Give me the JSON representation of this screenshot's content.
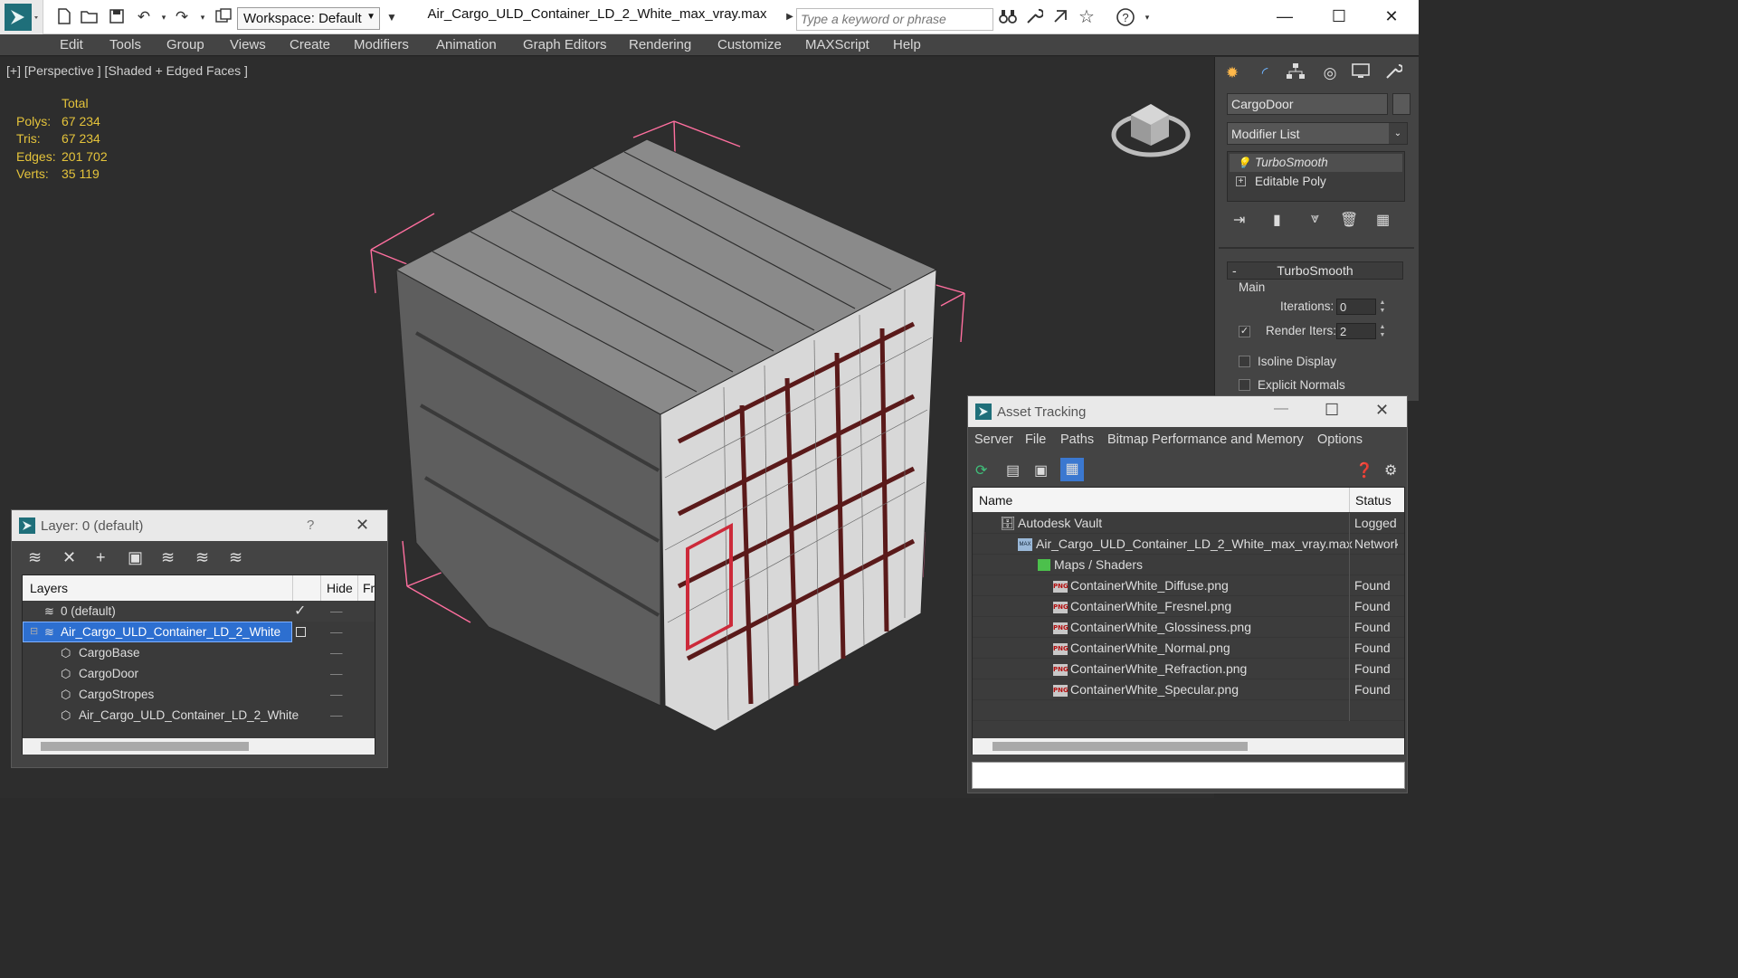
{
  "titlebar": {
    "workspace_label": "Workspace: Default",
    "file_title": "Air_Cargo_ULD_Container_LD_2_White_max_vray.max",
    "search_placeholder": "Type a keyword or phrase"
  },
  "menu": [
    "Edit",
    "Tools",
    "Group",
    "Views",
    "Create",
    "Modifiers",
    "Animation",
    "Graph Editors",
    "Rendering",
    "Customize",
    "MAXScript",
    "Help"
  ],
  "viewport": {
    "label": "[+] [Perspective ] [Shaded + Edged Faces ]",
    "stats": {
      "total_label": "Total",
      "polys_label": "Polys:",
      "polys": "67 234",
      "tris_label": "Tris:",
      "tris": "67 234",
      "edges_label": "Edges:",
      "edges": "201 702",
      "verts_label": "Verts:",
      "verts": "35 119"
    }
  },
  "command_panel": {
    "object_name": "CargoDoor",
    "modifier_list": "Modifier List",
    "stack": [
      "TurboSmooth",
      "Editable Poly"
    ],
    "rollout_title": "TurboSmooth",
    "group_main": "Main",
    "iterations_label": "Iterations:",
    "iterations": "0",
    "render_iters_label": "Render Iters:",
    "render_iters": "2",
    "isoline_label": "Isoline Display",
    "explicit_normals_label": "Explicit Normals"
  },
  "layer_panel": {
    "title": "Layer: 0 (default)",
    "help": "?",
    "col_layers": "Layers",
    "col_hide": "Hide",
    "col_freeze": "Fr",
    "rows": [
      {
        "name": "0 (default)"
      },
      {
        "name": "Air_Cargo_ULD_Container_LD_2_White"
      },
      {
        "name": "CargoBase"
      },
      {
        "name": "CargoDoor"
      },
      {
        "name": "CargoStropes"
      },
      {
        "name": "Air_Cargo_ULD_Container_LD_2_White"
      }
    ]
  },
  "asset_panel": {
    "title": "Asset Tracking",
    "menu": [
      "Server",
      "File",
      "Paths",
      "Bitmap Performance and Memory",
      "Options"
    ],
    "col_name": "Name",
    "col_status": "Status",
    "rows": [
      {
        "name": "Autodesk Vault",
        "status": "Logged"
      },
      {
        "name": "Air_Cargo_ULD_Container_LD_2_White_max_vray.max",
        "status": "Network"
      },
      {
        "name": "Maps / Shaders",
        "status": ""
      },
      {
        "name": "ContainerWhite_Diffuse.png",
        "status": "Found"
      },
      {
        "name": "ContainerWhite_Fresnel.png",
        "status": "Found"
      },
      {
        "name": "ContainerWhite_Glossiness.png",
        "status": "Found"
      },
      {
        "name": "ContainerWhite_Normal.png",
        "status": "Found"
      },
      {
        "name": "ContainerWhite_Refraction.png",
        "status": "Found"
      },
      {
        "name": "ContainerWhite_Specular.png",
        "status": "Found"
      }
    ],
    "png_badge": "PNG"
  }
}
